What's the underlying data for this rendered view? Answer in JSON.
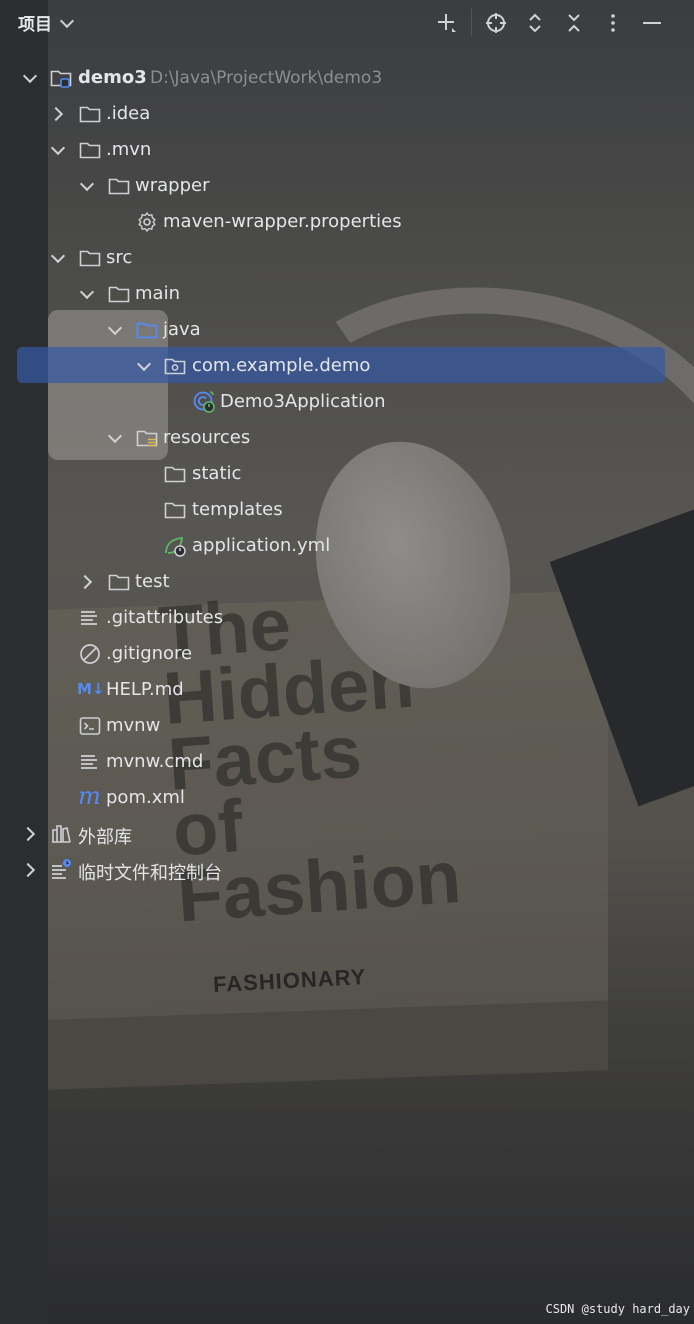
{
  "header": {
    "title": "项目",
    "toolbar": [
      "new-icon",
      "locate-icon",
      "expand-all-icon",
      "collapse-all-icon",
      "more-icon",
      "minimize-icon"
    ]
  },
  "tree": {
    "root_label": "demo3",
    "root_path": "D:\\Java\\ProjectWork\\demo3",
    "items": [
      {
        "label": "demo3"
      },
      {
        "label": ".idea"
      },
      {
        "label": ".mvn"
      },
      {
        "label": "wrapper"
      },
      {
        "label": "maven-wrapper.properties"
      },
      {
        "label": "src"
      },
      {
        "label": "main"
      },
      {
        "label": "java"
      },
      {
        "label": "com.example.demo"
      },
      {
        "label": "Demo3Application"
      },
      {
        "label": "resources"
      },
      {
        "label": "static"
      },
      {
        "label": "templates"
      },
      {
        "label": "application.yml"
      },
      {
        "label": "test"
      },
      {
        "label": ".gitattributes"
      },
      {
        "label": ".gitignore"
      },
      {
        "label": "HELP.md"
      },
      {
        "label": "mvnw"
      },
      {
        "label": "mvnw.cmd"
      },
      {
        "label": "pom.xml"
      },
      {
        "label": "外部库"
      },
      {
        "label": "临时文件和控制台"
      }
    ],
    "md_badge": "M↓",
    "maven_glyph": "m"
  },
  "watermark": "CSDN @study hard_day",
  "colors": {
    "panel_bg": "#2b2d30",
    "selection": "#3559a5",
    "folder_stroke": "#ced0d6",
    "source_folder": "#548af7",
    "spring_green": "#5fb865",
    "md_blue": "#548af7"
  }
}
